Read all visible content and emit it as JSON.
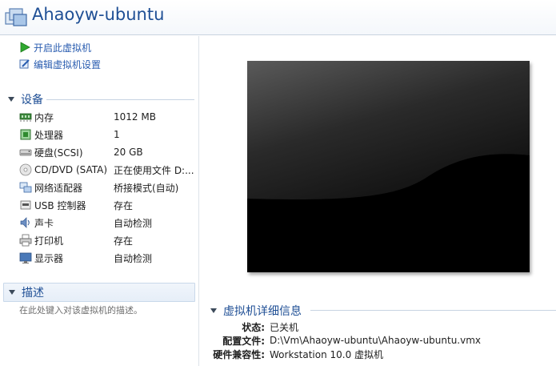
{
  "window": {
    "title": "Ahaoyw-ubuntu"
  },
  "actions": [
    {
      "label": "开启此虚拟机",
      "icon": "play-icon"
    },
    {
      "label": "编辑虚拟机设置",
      "icon": "edit-settings-icon"
    }
  ],
  "devices": {
    "title": "设备",
    "items": [
      {
        "name": "内存",
        "value": "1012 MB",
        "icon": "memory-icon"
      },
      {
        "name": "处理器",
        "value": "1",
        "icon": "processor-icon"
      },
      {
        "name": "硬盘(SCSI)",
        "value": "20 GB",
        "icon": "hard-disk-icon"
      },
      {
        "name": "CD/DVD (SATA)",
        "value": "正在使用文件 D:...",
        "icon": "cd-dvd-icon"
      },
      {
        "name": "网络适配器",
        "value": "桥接模式(自动)",
        "icon": "network-adapter-icon"
      },
      {
        "name": "USB 控制器",
        "value": "存在",
        "icon": "usb-controller-icon"
      },
      {
        "name": "声卡",
        "value": "自动检测",
        "icon": "sound-card-icon"
      },
      {
        "name": "打印机",
        "value": "存在",
        "icon": "printer-icon"
      },
      {
        "name": "显示器",
        "value": "自动检测",
        "icon": "display-icon"
      }
    ]
  },
  "description": {
    "title": "描述",
    "placeholder": "在此处键入对该虚拟机的描述。"
  },
  "details": {
    "title": "虚拟机详细信息",
    "rows": [
      {
        "key": "状态:",
        "value": "已关机"
      },
      {
        "key": "配置文件:",
        "value": "D:\\Vm\\Ahaoyw-ubuntu\\Ahaoyw-ubuntu.vmx"
      },
      {
        "key": "硬件兼容性:",
        "value": "Workstation 10.0 虚拟机"
      }
    ]
  },
  "colors": {
    "accent": "#1f4f95",
    "link": "#2a5db0",
    "screen": "#000000"
  }
}
